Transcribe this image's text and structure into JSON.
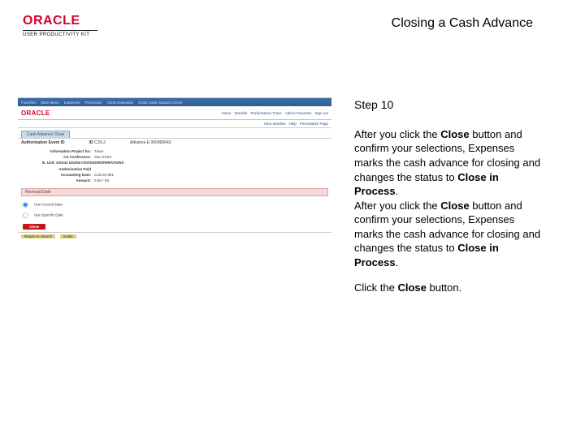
{
  "header": {
    "logo_text": "ORACLE",
    "logo_subtext": "USER PRODUCTIVITY KIT",
    "page_title": "Closing a Cash Advance"
  },
  "right": {
    "step_label": "Step 10",
    "p1a": "After you click the ",
    "p1b": "Close",
    "p1c": " button and confirm your selections, Expenses marks the cash advance for closing and changes the status to ",
    "p1d": "Close in Process",
    "p1e": ".",
    "p2a": "After you click the ",
    "p2b": "Close",
    "p2c": " button and confirm your selections, Expenses marks the cash advance for closing and changes the status to ",
    "p2d": "Close in Process",
    "p2e": ".",
    "p3a": "Click the ",
    "p3b": "Close",
    "p3c": " button."
  },
  "app": {
    "topbar": {
      "t1": "Favorites",
      "t2": "Main Menu",
      "t3": "Expenses",
      "t4": "Processes",
      "t5": "Close Expenses",
      "t6": "Close Cash Advance Close"
    },
    "brand": "ORACLE",
    "brand_links": {
      "l1": "Home",
      "l2": "Worklist",
      "l3": "Performance Trace",
      "l4": "Add to Favorites",
      "l5": "Sign out"
    },
    "subhdr": {
      "s1": "New Window",
      "s2": "Help",
      "s3": "Personalize Page"
    },
    "tab_label": "Cash Advance Close",
    "row1": {
      "label": "Authorization Event ID",
      "id_label": "ID",
      "id_val": "CJS-2",
      "adv_label": "Advance E",
      "adv_val": "000000043"
    },
    "fields": {
      "f1k": "Information Project for:",
      "f1v": "Trace",
      "f2k": "CS Conference:",
      "f2v": "San XXXX",
      "f3v": "B. Unit: USS41  US204-CNVISION\\OPERATIONS",
      "f4k": "Authorization Paid",
      "f5k": "Accounting Date:",
      "f5v": "CJS-01-001",
      "f6k": "Amount:",
      "f6v": "0.00 / SS"
    },
    "accordion_label": "Reversal Date",
    "opt1": "Use Current Date",
    "opt2": "Use Specific Date",
    "close_btn": "Close",
    "footer": {
      "c1": "Return to Search",
      "c2": "Notify"
    }
  }
}
